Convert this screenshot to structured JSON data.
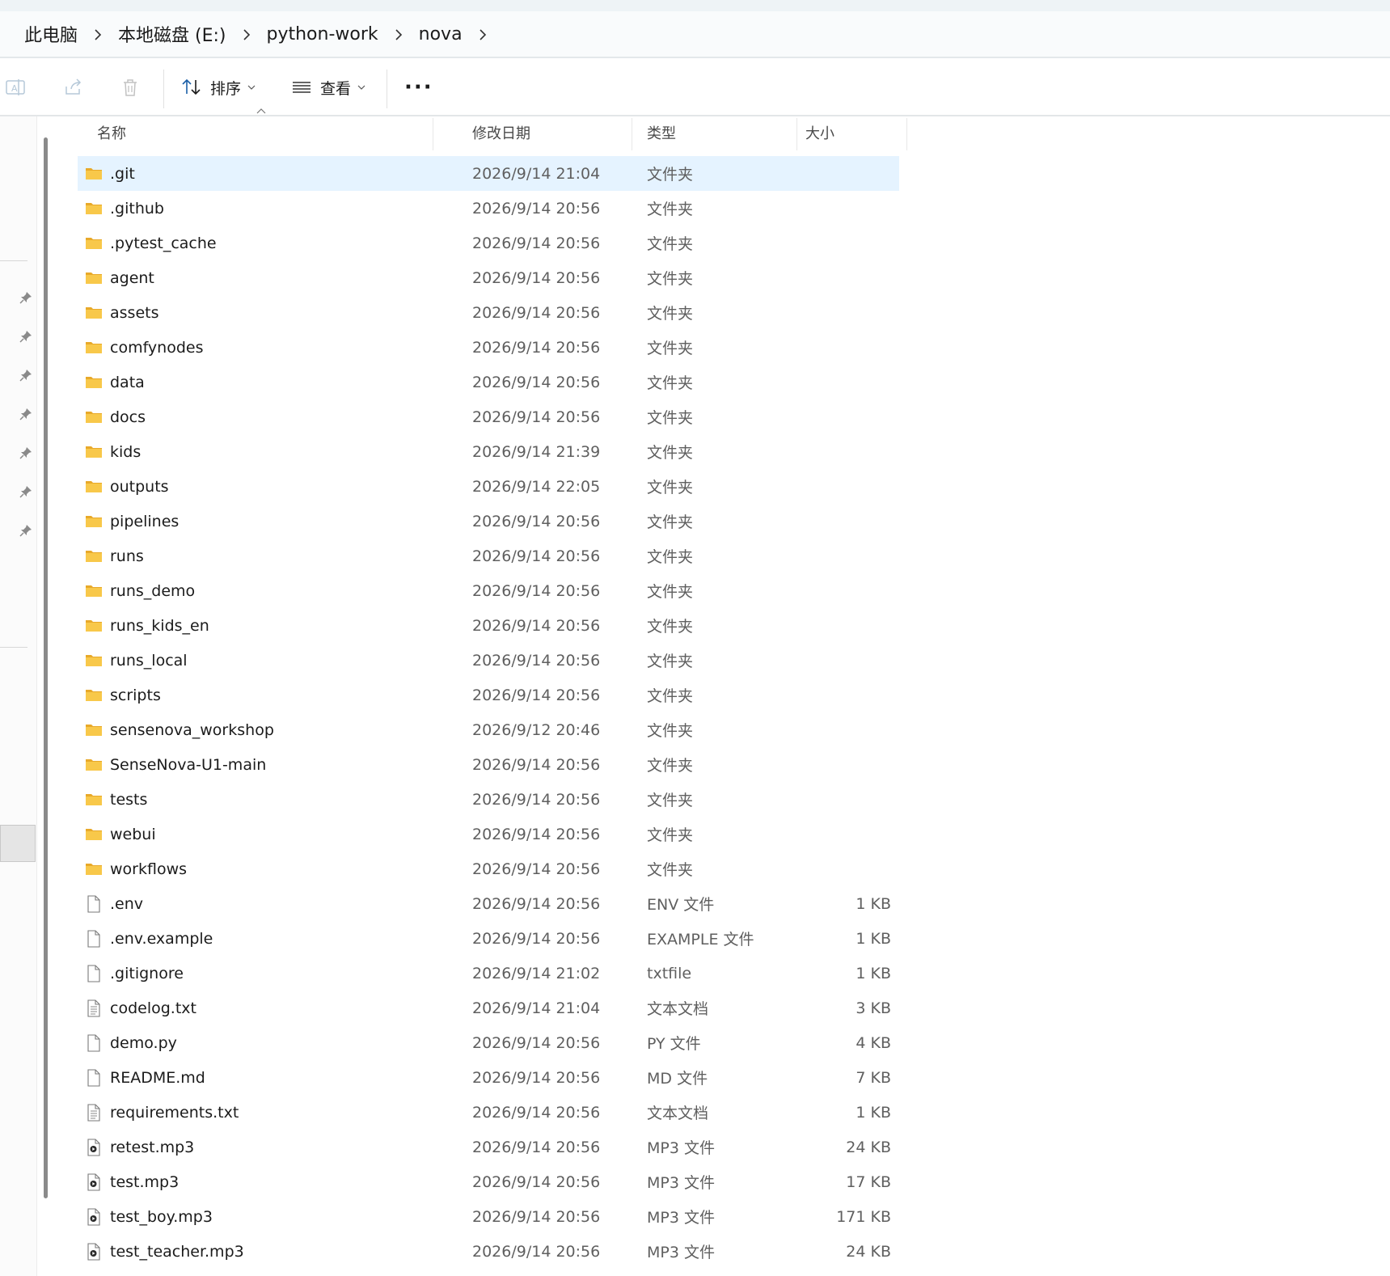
{
  "breadcrumb": [
    {
      "label": "此电脑"
    },
    {
      "label": "本地磁盘 (E:)"
    },
    {
      "label": "python-work"
    },
    {
      "label": "nova"
    }
  ],
  "toolbar": {
    "sort_label": "排序",
    "view_label": "查看",
    "more_label": "···"
  },
  "columns": {
    "name": "名称",
    "date": "修改日期",
    "type": "类型",
    "size": "大小"
  },
  "files": [
    {
      "name": ".git",
      "date": "2026/9/14 21:04",
      "type": "文件夹",
      "size": "",
      "icon": "folder-icon",
      "selected": true
    },
    {
      "name": ".github",
      "date": "2026/9/14 20:56",
      "type": "文件夹",
      "size": "",
      "icon": "folder-icon"
    },
    {
      "name": ".pytest_cache",
      "date": "2026/9/14 20:56",
      "type": "文件夹",
      "size": "",
      "icon": "folder-icon"
    },
    {
      "name": "agent",
      "date": "2026/9/14 20:56",
      "type": "文件夹",
      "size": "",
      "icon": "folder-icon"
    },
    {
      "name": "assets",
      "date": "2026/9/14 20:56",
      "type": "文件夹",
      "size": "",
      "icon": "folder-icon"
    },
    {
      "name": "comfynodes",
      "date": "2026/9/14 20:56",
      "type": "文件夹",
      "size": "",
      "icon": "folder-icon"
    },
    {
      "name": "data",
      "date": "2026/9/14 20:56",
      "type": "文件夹",
      "size": "",
      "icon": "folder-icon"
    },
    {
      "name": "docs",
      "date": "2026/9/14 20:56",
      "type": "文件夹",
      "size": "",
      "icon": "folder-icon"
    },
    {
      "name": "kids",
      "date": "2026/9/14 21:39",
      "type": "文件夹",
      "size": "",
      "icon": "folder-icon"
    },
    {
      "name": "outputs",
      "date": "2026/9/14 22:05",
      "type": "文件夹",
      "size": "",
      "icon": "folder-icon"
    },
    {
      "name": "pipelines",
      "date": "2026/9/14 20:56",
      "type": "文件夹",
      "size": "",
      "icon": "folder-icon"
    },
    {
      "name": "runs",
      "date": "2026/9/14 20:56",
      "type": "文件夹",
      "size": "",
      "icon": "folder-icon"
    },
    {
      "name": "runs_demo",
      "date": "2026/9/14 20:56",
      "type": "文件夹",
      "size": "",
      "icon": "folder-icon"
    },
    {
      "name": "runs_kids_en",
      "date": "2026/9/14 20:56",
      "type": "文件夹",
      "size": "",
      "icon": "folder-icon"
    },
    {
      "name": "runs_local",
      "date": "2026/9/14 20:56",
      "type": "文件夹",
      "size": "",
      "icon": "folder-icon"
    },
    {
      "name": "scripts",
      "date": "2026/9/14 20:56",
      "type": "文件夹",
      "size": "",
      "icon": "folder-icon"
    },
    {
      "name": "sensenova_workshop",
      "date": "2026/9/12 20:46",
      "type": "文件夹",
      "size": "",
      "icon": "folder-icon"
    },
    {
      "name": "SenseNova-U1-main",
      "date": "2026/9/14 20:56",
      "type": "文件夹",
      "size": "",
      "icon": "folder-icon"
    },
    {
      "name": "tests",
      "date": "2026/9/14 20:56",
      "type": "文件夹",
      "size": "",
      "icon": "folder-icon"
    },
    {
      "name": "webui",
      "date": "2026/9/14 20:56",
      "type": "文件夹",
      "size": "",
      "icon": "folder-icon"
    },
    {
      "name": "workflows",
      "date": "2026/9/14 20:56",
      "type": "文件夹",
      "size": "",
      "icon": "folder-icon"
    },
    {
      "name": ".env",
      "date": "2026/9/14 20:56",
      "type": "ENV 文件",
      "size": "1 KB",
      "icon": "file-icon"
    },
    {
      "name": ".env.example",
      "date": "2026/9/14 20:56",
      "type": "EXAMPLE 文件",
      "size": "1 KB",
      "icon": "file-icon"
    },
    {
      "name": ".gitignore",
      "date": "2026/9/14 21:02",
      "type": "txtfile",
      "size": "1 KB",
      "icon": "file-icon"
    },
    {
      "name": "codelog.txt",
      "date": "2026/9/14 21:04",
      "type": "文本文档",
      "size": "3 KB",
      "icon": "text-file-icon"
    },
    {
      "name": "demo.py",
      "date": "2026/9/14 20:56",
      "type": "PY 文件",
      "size": "4 KB",
      "icon": "file-icon"
    },
    {
      "name": "README.md",
      "date": "2026/9/14 20:56",
      "type": "MD 文件",
      "size": "7 KB",
      "icon": "file-icon"
    },
    {
      "name": "requirements.txt",
      "date": "2026/9/14 20:56",
      "type": "文本文档",
      "size": "1 KB",
      "icon": "text-file-icon"
    },
    {
      "name": "retest.mp3",
      "date": "2026/9/14 20:56",
      "type": "MP3 文件",
      "size": "24 KB",
      "icon": "audio-file-icon"
    },
    {
      "name": "test.mp3",
      "date": "2026/9/14 20:56",
      "type": "MP3 文件",
      "size": "17 KB",
      "icon": "audio-file-icon"
    },
    {
      "name": "test_boy.mp3",
      "date": "2026/9/14 20:56",
      "type": "MP3 文件",
      "size": "171 KB",
      "icon": "audio-file-icon"
    },
    {
      "name": "test_teacher.mp3",
      "date": "2026/9/14 20:56",
      "type": "MP3 文件",
      "size": "24 KB",
      "icon": "audio-file-icon"
    }
  ],
  "colors": {
    "folder": "#f8c84a",
    "folder_dark": "#e8a92a",
    "selection": "#e5f3ff",
    "accent": "#0067c0"
  }
}
